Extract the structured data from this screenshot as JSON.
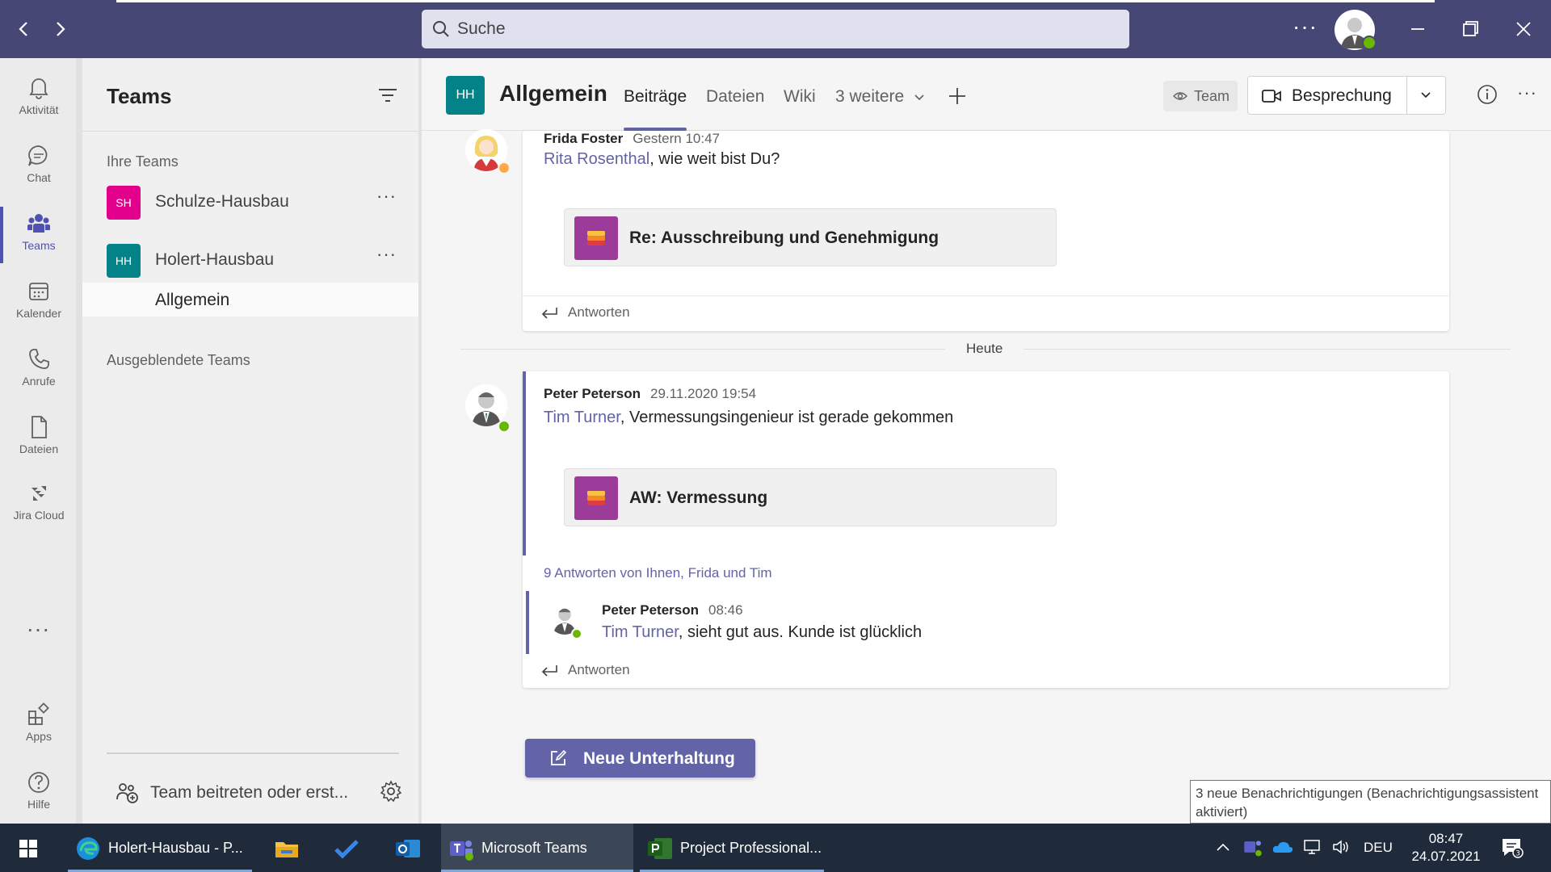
{
  "search": {
    "placeholder": "Suche"
  },
  "rail": {
    "items": [
      {
        "label": "Aktivität",
        "icon": "bell-icon"
      },
      {
        "label": "Chat",
        "icon": "chat-icon"
      },
      {
        "label": "Teams",
        "icon": "teams-icon",
        "active": true
      },
      {
        "label": "Kalender",
        "icon": "calendar-icon"
      },
      {
        "label": "Anrufe",
        "icon": "phone-icon"
      },
      {
        "label": "Dateien",
        "icon": "file-icon"
      },
      {
        "label": "Jira Cloud",
        "icon": "jira-icon"
      }
    ],
    "more": "...",
    "bottom": [
      {
        "label": "Apps",
        "icon": "apps-icon"
      },
      {
        "label": "Hilfe",
        "icon": "help-icon"
      }
    ]
  },
  "panel": {
    "title": "Teams",
    "your_teams_label": "Ihre Teams",
    "teams": [
      {
        "initials": "SH",
        "name": "Schulze-Hausbau",
        "color": "#e3008c"
      },
      {
        "initials": "HH",
        "name": "Holert-Hausbau",
        "color": "#038387"
      }
    ],
    "selected_channel": "Allgemein",
    "hidden_teams_label": "Ausgeblendete Teams",
    "join_label": "Team beitreten oder erst..."
  },
  "header": {
    "tile_initials": "HH",
    "title": "Allgemein",
    "tabs": [
      "Beiträge",
      "Dateien",
      "Wiki",
      "3 weitere"
    ],
    "team_pill": "Team",
    "meeting_label": "Besprechung"
  },
  "messages": [
    {
      "author": "Frida Foster",
      "time": "Gestern 10:47",
      "mention": "Rita Rosenthal",
      "text": ", wie weit bist Du?",
      "attachment": "Re: Ausschreibung und Genehmigung",
      "reply_label": "Antworten"
    },
    {
      "author": "Peter Peterson",
      "time": "29.11.2020 19:54",
      "mention": "Tim Turner",
      "text": ", Vermessungsingenieur ist gerade gekommen",
      "attachment": "AW: Vermessung",
      "replies_summary": "9 Antworten von Ihnen, Frida und Tim",
      "reply": {
        "author": "Peter Peterson",
        "time": "08:46",
        "mention": "Tim Turner",
        "text": ", sieht gut aus. Kunde ist glücklich"
      },
      "reply_label": "Antworten"
    }
  ],
  "date_divider": "Heute",
  "new_conversation": "Neue Unterhaltung",
  "tooltip": "3 neue Benachrichtigungen (Benachrichtigungsassistent aktiviert)",
  "taskbar": {
    "apps": [
      {
        "label": "Holert-Hausbau - P...",
        "icon": "edge-icon"
      },
      {
        "label": "",
        "icon": "explorer-icon"
      },
      {
        "label": "",
        "icon": "todo-icon"
      },
      {
        "label": "",
        "icon": "outlook-icon"
      },
      {
        "label": "Microsoft Teams",
        "icon": "teams-icon"
      },
      {
        "label": "Project Professional...",
        "icon": "project-icon"
      }
    ],
    "language": "DEU",
    "time": "08:47",
    "date": "24.07.2021"
  },
  "colors": {
    "titlebar": "#464775",
    "accent": "#6264a7",
    "available": "#6bb700",
    "away": "#ffaa44"
  }
}
